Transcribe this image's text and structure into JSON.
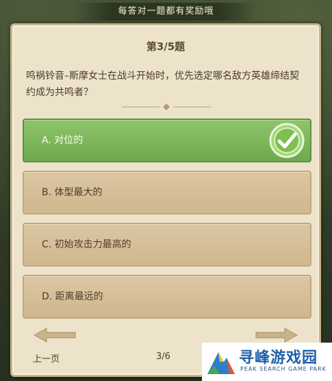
{
  "banner": {
    "text": "每答对一题都有奖励哦"
  },
  "quiz": {
    "number_label": "第3/5题",
    "question": "鸣祸铃音–斯摩女士在战斗开始时，优先选定哪名敌方英雄缔结契约成为共鸣者？",
    "options": [
      {
        "label": "A. 对位的",
        "state": "correct"
      },
      {
        "label": "B. 体型最大的",
        "state": "normal"
      },
      {
        "label": "C. 初始攻击力最高的",
        "state": "normal"
      },
      {
        "label": "D. 距离最远的",
        "state": "normal"
      }
    ]
  },
  "footer": {
    "prev_label": "上一页",
    "page_indicator": "3/6"
  },
  "watermark": {
    "title": "寻峰游戏园",
    "subtitle": "PEAK SEARCH GAME PARK"
  },
  "colors": {
    "panel": "#ede3cb",
    "option": "#d6c09a",
    "correct": "#7db45a",
    "text": "#4e3c28"
  }
}
